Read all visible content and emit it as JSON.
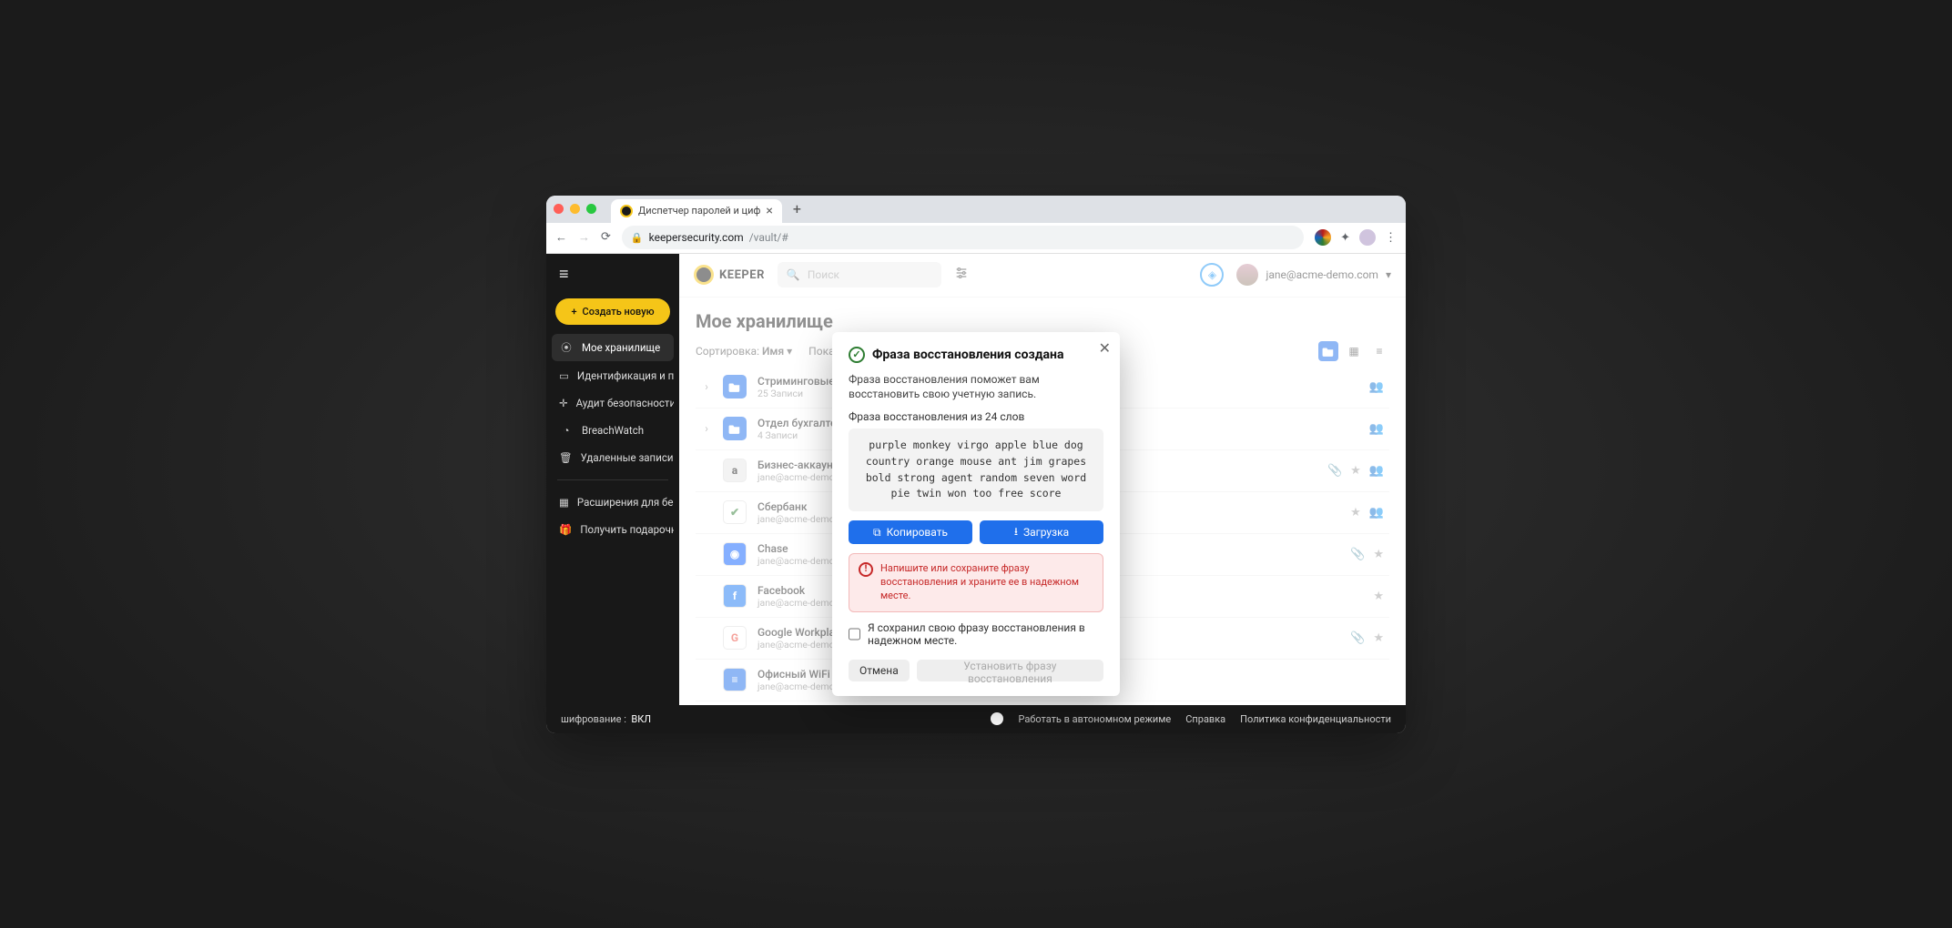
{
  "browser": {
    "tab_title": "Диспетчер паролей и циф",
    "url_domain": "keepersecurity.com",
    "url_path": "/vault/#"
  },
  "header": {
    "brand": "KEEPER",
    "search_placeholder": "Поиск",
    "user_email": "jane@acme-demo.com"
  },
  "sidebar": {
    "create_label": "Создать новую",
    "items": [
      {
        "label": "Мое хранилище",
        "icon": "⦿"
      },
      {
        "label": "Идентификация и пл…",
        "icon": "▭"
      },
      {
        "label": "Аудит безопасности",
        "icon": "✛"
      },
      {
        "label": "BreachWatch",
        "icon": "◔"
      },
      {
        "label": "Удаленные записи",
        "icon": "🗑"
      }
    ],
    "extra": [
      {
        "label": "Расширения для без…",
        "icon": "▦"
      },
      {
        "label": "Получить подарочн…",
        "icon": "🎁"
      }
    ]
  },
  "vault": {
    "title": "Мое хранилище",
    "sort_label": "Сортировка:",
    "sort_value": "Имя",
    "show_label": "Показа",
    "folders": [
      {
        "name": "Стриминговые с",
        "sub": "25 Записи"
      },
      {
        "name": "Отдел бухгалтер",
        "sub": "4 Записи"
      }
    ],
    "records": [
      {
        "name": "Бизнес-аккаунт А",
        "sub": "jane@acme-demo.c",
        "bg": "#e6e6e6",
        "fg": "#111",
        "letter": "a",
        "actions": [
          "clip",
          "star",
          "share"
        ]
      },
      {
        "name": "Сбербанк",
        "sub": "jane@acme-demo.c",
        "bg": "#fff",
        "fg": "#2e7d32",
        "letter": "✔",
        "actions": [
          "star",
          "share"
        ]
      },
      {
        "name": "Chase",
        "sub": "jane@acme-demo.c",
        "bg": "#0b5fff",
        "fg": "#fff",
        "letter": "◉",
        "actions": [
          "clip",
          "star"
        ]
      },
      {
        "name": "Facebook",
        "sub": "jane@acme-demo.c",
        "bg": "#1877f2",
        "fg": "#fff",
        "letter": "f",
        "actions": [
          "star"
        ]
      },
      {
        "name": "Google Workplace",
        "sub": "jane@acme-demo.c",
        "bg": "#fff",
        "fg": "#ea4335",
        "letter": "G",
        "actions": [
          "clip",
          "star"
        ]
      },
      {
        "name": "Офисный WiFi",
        "sub": "jane@acme-demo.com",
        "bg": "#1f6feb",
        "fg": "#fff",
        "letter": "≡",
        "actions": []
      }
    ]
  },
  "modal": {
    "title": "Фраза восстановления создана",
    "desc": "Фраза восстановления поможет вам восстановить свою учетную запись.",
    "phrase_label": "Фраза восстановления из 24 слов",
    "phrase": "purple monkey virgo apple blue dog\ncountry orange mouse ant jim grapes\nbold strong agent random seven word\npie twin won too free score",
    "copy": "Копировать",
    "download": "Загрузка",
    "warning": "Напишите или сохраните фразу восстановления и храните ее в надежном месте.",
    "checkbox": "Я сохранил свою фразу восстановления в надежном месте.",
    "cancel": "Отмена",
    "submit": "Установить фразу восстановления"
  },
  "status": {
    "enc_label": "шифрование :",
    "enc_value": "ВКЛ",
    "offline": "Работать в автономном режиме",
    "help": "Справка",
    "privacy": "Политика конфиденциальности"
  }
}
